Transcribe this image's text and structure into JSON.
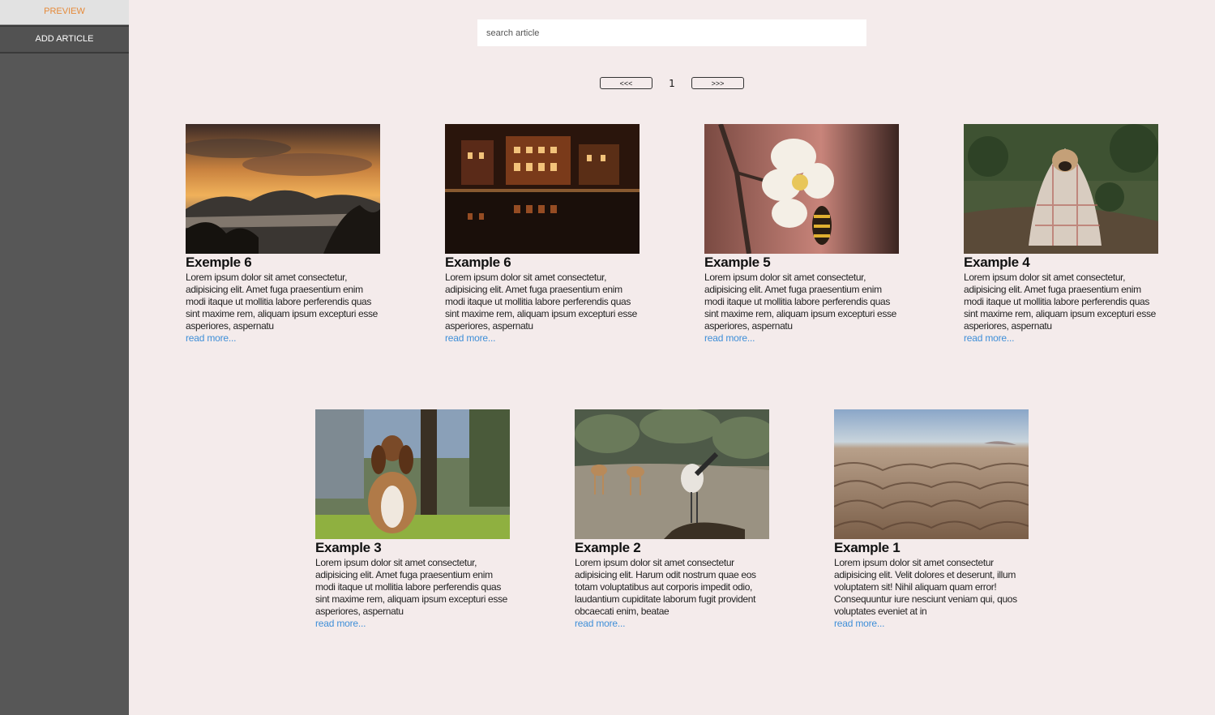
{
  "sidebar": {
    "preview_label": "PREVIEW",
    "add_article_label": "ADD ARTICLE"
  },
  "search": {
    "placeholder": "search article"
  },
  "pagination": {
    "prev_label": "<<<",
    "page": "1",
    "next_label": ">>>"
  },
  "articles": [
    {
      "title": "Exemple 6",
      "text": "Lorem ipsum dolor sit amet consectetur, adipisicing elit. Amet fuga praesentium enim modi itaque ut mollitia labore perferendis quas sint maxime rem, aliquam ipsum excepturi esse asperiores, aspernatu",
      "link": "read more...",
      "image": "sunset-forest-mountains"
    },
    {
      "title": "Example 6",
      "text": "Lorem ipsum dolor sit amet consectetur, adipisicing elit. Amet fuga praesentium enim modi itaque ut mollitia labore perferendis quas sint maxime rem, aliquam ipsum excepturi esse asperiores, aspernatu",
      "link": "read more...",
      "image": "night-street-reflection"
    },
    {
      "title": "Example 5",
      "text": "Lorem ipsum dolor sit amet consectetur, adipisicing elit. Amet fuga praesentium enim modi itaque ut mollitia labore perferendis quas sint maxime rem, aliquam ipsum excepturi esse asperiores, aspernatu",
      "link": "read more...",
      "image": "bee-on-blossom"
    },
    {
      "title": "Example 4",
      "text": "Lorem ipsum dolor sit amet consectetur, adipisicing elit. Amet fuga praesentium enim modi itaque ut mollitia labore perferendis quas sint maxime rem, aliquam ipsum excepturi esse asperiores, aspernatu",
      "link": "read more...",
      "image": "pug-in-blanket"
    },
    {
      "title": "Example 3",
      "text": "Lorem ipsum dolor sit amet consectetur, adipisicing elit. Amet fuga praesentium enim modi itaque ut mollitia labore perferendis quas sint maxime rem, aliquam ipsum excepturi esse asperiores, aspernatu",
      "link": "read more...",
      "image": "dog-sitting"
    },
    {
      "title": "Example 2",
      "text": "Lorem ipsum dolor sit amet consectetur adipisicing elit. Harum odit nostrum quae eos totam voluptatibus aut corporis impedit odio, laudantium cupiditate laborum fugit provident obcaecati enim, beatae",
      "link": "read more...",
      "image": "cranes-and-deer"
    },
    {
      "title": "Example 1",
      "text": "Lorem ipsum dolor sit amet consectetur adipisicing elit. Velit dolores et deserunt, illum voluptatem sit! Nihil aliquam quam error! Consequuntur iure nesciunt veniam qui, quos voluptates eveniet at in",
      "link": "read more...",
      "image": "desert-badlands"
    }
  ]
}
